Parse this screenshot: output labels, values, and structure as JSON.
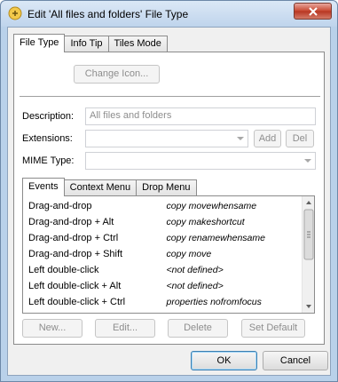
{
  "window": {
    "title": "Edit 'All files and folders' File Type"
  },
  "tabs": [
    "File Type",
    "Info Tip",
    "Tiles Mode"
  ],
  "file_type": {
    "change_icon_label": "Change Icon...",
    "description_label": "Description:",
    "description_value": "All files and folders",
    "extensions_label": "Extensions:",
    "extensions_value": "",
    "add_label": "Add",
    "del_label": "Del",
    "mime_label": "MIME Type:",
    "mime_value": ""
  },
  "event_tabs": [
    "Events",
    "Context Menu",
    "Drop Menu"
  ],
  "events": [
    {
      "event": "Drag-and-drop",
      "action": "copy movewhensame"
    },
    {
      "event": "Drag-and-drop + Alt",
      "action": "copy makeshortcut"
    },
    {
      "event": "Drag-and-drop + Ctrl",
      "action": "copy renamewhensame"
    },
    {
      "event": "Drag-and-drop + Shift",
      "action": "copy move"
    },
    {
      "event": "Left double-click",
      "action": "<not defined>"
    },
    {
      "event": "Left double-click + Alt",
      "action": "<not defined>"
    },
    {
      "event": "Left double-click + Ctrl",
      "action": "properties nofromfocus"
    }
  ],
  "event_buttons": {
    "new_label": "New...",
    "edit_label": "Edit...",
    "delete_label": "Delete",
    "set_default_label": "Set Default"
  },
  "dialog_buttons": {
    "ok_label": "OK",
    "cancel_label": "Cancel"
  }
}
